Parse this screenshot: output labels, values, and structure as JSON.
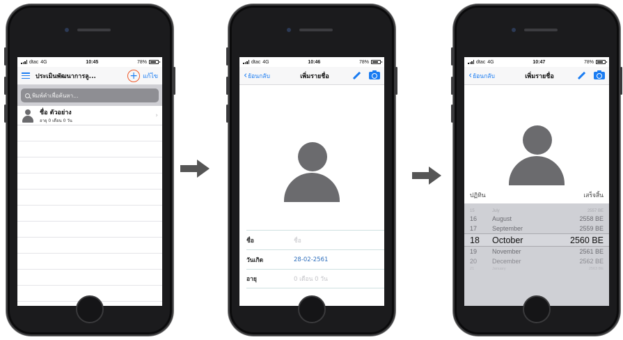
{
  "status_bars": [
    {
      "carrier": "dtac",
      "network": "4G",
      "time": "10:45",
      "battery": "78%"
    },
    {
      "carrier": "dtac",
      "network": "4G",
      "time": "10:46",
      "battery": "78%"
    },
    {
      "carrier": "dtac",
      "network": "4G",
      "time": "10:47",
      "battery": "78%"
    }
  ],
  "list_screen": {
    "title": "ประเมินพัฒนาการลู...",
    "add_symbol": "+",
    "edit_label": "แก้ไข",
    "search_placeholder": "พิมพ์คำเพื่อค้นหา...",
    "contacts": [
      {
        "name": "ชื่อ ตัวอย่าง",
        "age": "อายุ 0 เดือน 0 วัน"
      }
    ]
  },
  "add_screen": {
    "back_label": "ย้อนกลับ",
    "title": "เพิ่มรายชื่อ",
    "fields": [
      {
        "label": "ชื่อ",
        "value": "ชื่อ",
        "placeholder": true
      },
      {
        "label": "วันเกิด",
        "value": "28-02-2561",
        "placeholder": false
      },
      {
        "label": "อายุ",
        "value": "0 เดือน 0 วัน",
        "placeholder": true
      }
    ]
  },
  "picker_screen": {
    "back_label": "ย้อนกลับ",
    "title": "เพิ่มรายชื่อ",
    "cancel_label": "ปฏิทิน",
    "done_label": "เสร็จสิ้น",
    "rows": [
      {
        "day": "15",
        "month": "July",
        "year": "2557 BE"
      },
      {
        "day": "16",
        "month": "August",
        "year": "2558 BE"
      },
      {
        "day": "17",
        "month": "September",
        "year": "2559 BE"
      },
      {
        "day": "18",
        "month": "October",
        "year": "2560 BE"
      },
      {
        "day": "19",
        "month": "November",
        "year": "2561 BE"
      },
      {
        "day": "20",
        "month": "December",
        "year": "2562 BE"
      },
      {
        "day": "21",
        "month": "January",
        "year": "2563 BE"
      }
    ]
  },
  "icons": [
    "hamburger-icon",
    "plus-icon",
    "search-icon",
    "chevron-right-icon",
    "back-chevron-icon",
    "pencil-icon",
    "camera-icon",
    "avatar-icon",
    "arrow-right-icon"
  ],
  "colors": {
    "accent": "#1a7cf2",
    "highlight_ring": "#ef5a2a",
    "avatar": "#6b6b6e",
    "picker_bg": "#cfd0d5"
  }
}
